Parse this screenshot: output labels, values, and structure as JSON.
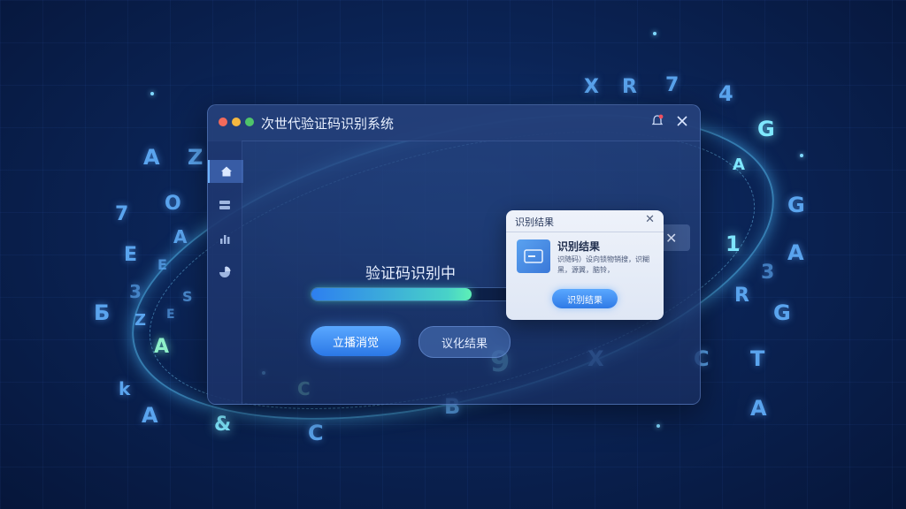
{
  "window": {
    "title": "次世代验证码识别系统",
    "traffic_lights": [
      "#f26a5b",
      "#f4b740",
      "#4fc46a"
    ],
    "icons": [
      "notification-icon",
      "close-icon"
    ]
  },
  "sidebar": {
    "items": [
      {
        "icon": "home-icon",
        "active": true
      },
      {
        "icon": "layers-icon",
        "active": false
      },
      {
        "icon": "bar-chart-icon",
        "active": false
      },
      {
        "icon": "pie-chart-icon",
        "active": false
      }
    ]
  },
  "main": {
    "status_text": "验证码识别中",
    "progress": 0.8,
    "primary_button": "立播消觉",
    "secondary_button": "议化结果"
  },
  "popup": {
    "title": "识别结果",
    "heading": "识别结果",
    "description": "识随码）设向锁物销搜，识糊黑，源翼，脑铃，",
    "button": "识别结果"
  },
  "floating_glyphs": [
    "X",
    "R",
    "7",
    "4",
    "G",
    "A",
    "G",
    "1",
    "A",
    "3",
    "R",
    "G",
    "C",
    "T",
    "A",
    "X",
    "9",
    "B",
    "C",
    "C",
    "&",
    "A",
    "k",
    "Б",
    "A",
    "Z",
    "E",
    "O",
    "A",
    "Z",
    "7",
    "E",
    "A",
    "3",
    "S",
    "C",
    "E"
  ]
}
